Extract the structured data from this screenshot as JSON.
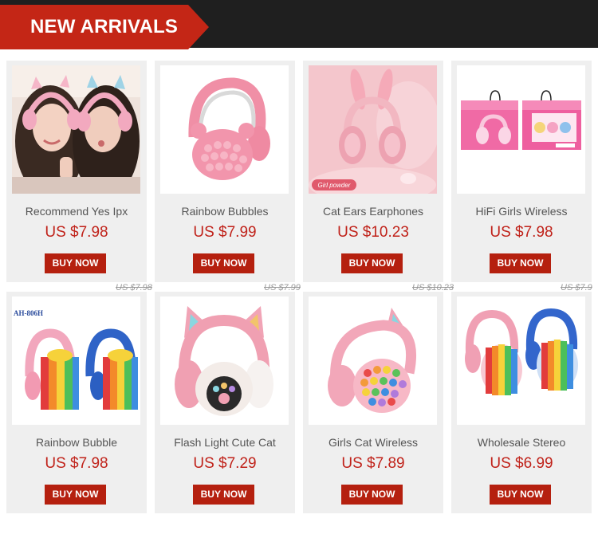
{
  "header": {
    "title": "NEW ARRIVALS"
  },
  "colors": {
    "accent": "#b5200f",
    "banner": "#c42616",
    "header_bg": "#1f1f1f"
  },
  "products": [
    {
      "title": "Recommend Yes Ipx",
      "price": "US $7.98",
      "old_price": "US $7.98",
      "button": "BUY NOW"
    },
    {
      "title": "Rainbow Bubbles",
      "price": "US $7.99",
      "old_price": "US $7.99",
      "button": "BUY NOW"
    },
    {
      "title": "Cat Ears Earphones",
      "price": "US $10.23",
      "old_price": "US $10.23",
      "button": "BUY NOW",
      "image_label": "Girl powder"
    },
    {
      "title": "HiFi Girls Wireless",
      "price": "US $7.98",
      "old_price": "US $7.9",
      "button": "BUY NOW"
    },
    {
      "title": "Rainbow Bubble",
      "price": "US $7.98",
      "button": "BUY NOW",
      "image_label": "AH-806H"
    },
    {
      "title": "Flash Light Cute Cat",
      "price": "US $7.29",
      "button": "BUY NOW"
    },
    {
      "title": "Girls Cat Wireless",
      "price": "US $7.89",
      "button": "BUY NOW"
    },
    {
      "title": "Wholesale Stereo",
      "price": "US $6.99",
      "button": "BUY NOW"
    }
  ]
}
